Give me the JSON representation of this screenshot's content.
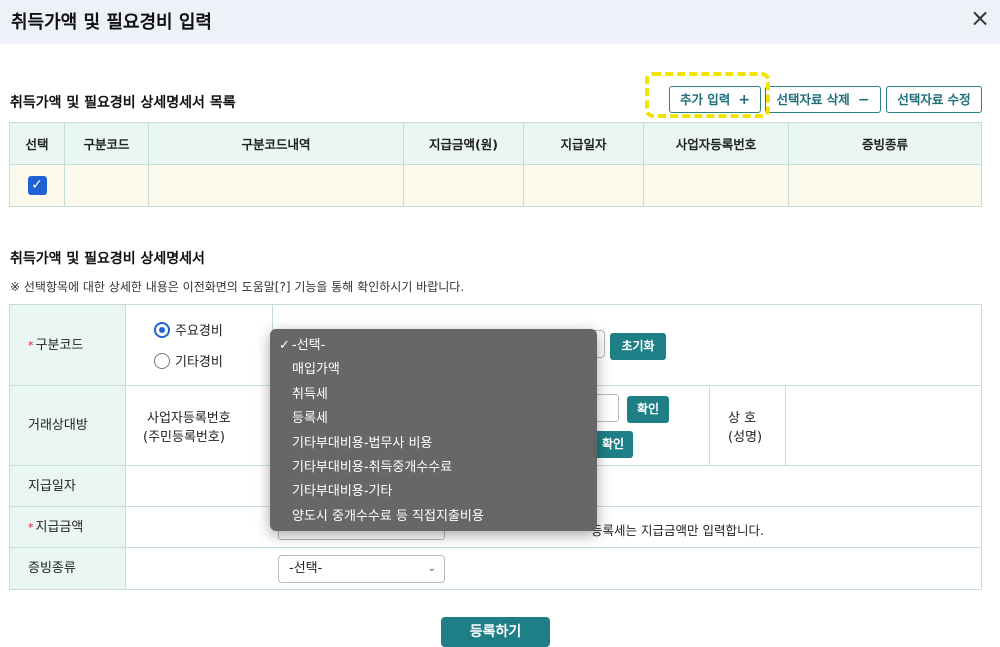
{
  "header": {
    "title": "취득가액 및 필요경비 입력",
    "close_icon": "×"
  },
  "list_section": {
    "title": "취득가액 및 필요경비 상세명세서 목록",
    "buttons": {
      "add": "추가 입력",
      "add_sym": "+",
      "delete": "선택자료 삭제",
      "delete_sym": "−",
      "edit": "선택자료 수정"
    },
    "columns": [
      "선택",
      "구분코드",
      "구분코드내역",
      "지급금액(원)",
      "지급일자",
      "사업자등록번호",
      "증빙종류"
    ],
    "rows": [
      {
        "checked": true,
        "check_mark": "✓"
      }
    ]
  },
  "detail_section": {
    "title": "취득가액 및 필요경비 상세명세서",
    "note": "※ 선택항목에 대한 상세한 내용은 이전화면의 도움말[?] 기능을 통해 확인하시기 바랍니다.",
    "code": {
      "label": "구분코드",
      "req": "*",
      "radio_main": "주요경비",
      "radio_other": "기타경비",
      "selected": "주요경비",
      "reset": "초기화"
    },
    "counterparty": {
      "label": "거래상대방",
      "reg_label_1": "사업자등록번호",
      "reg_label_2": "(주민등록번호)",
      "confirm": "확인",
      "confirm2": "확인",
      "name_label_1": "상 호",
      "name_label_2": "(성명)"
    },
    "pay_date": {
      "label": "지급일자"
    },
    "pay_amount": {
      "label": "지급금액",
      "req": "*",
      "hint": "등록세는 지급금액만 입력합니다."
    },
    "evidence": {
      "label": "증빙종류",
      "value": "-선택-"
    }
  },
  "dropdown": {
    "selected_mark": "✓",
    "options": [
      "-선택-",
      "매입가액",
      "취득세",
      "등록세",
      "기타부대비용-법무사 비용",
      "기타부대비용-취득중개수수료",
      "기타부대비용-기타",
      "양도시 중개수수료 등 직접지출비용"
    ]
  },
  "submit_label": "등록하기",
  "colors": {
    "teal": "#1f7f86",
    "header_bg": "#eef2f8",
    "table_header_bg": "#e9f6f4",
    "row_bg": "#fbf8ec",
    "highlight": "#f2e400"
  }
}
